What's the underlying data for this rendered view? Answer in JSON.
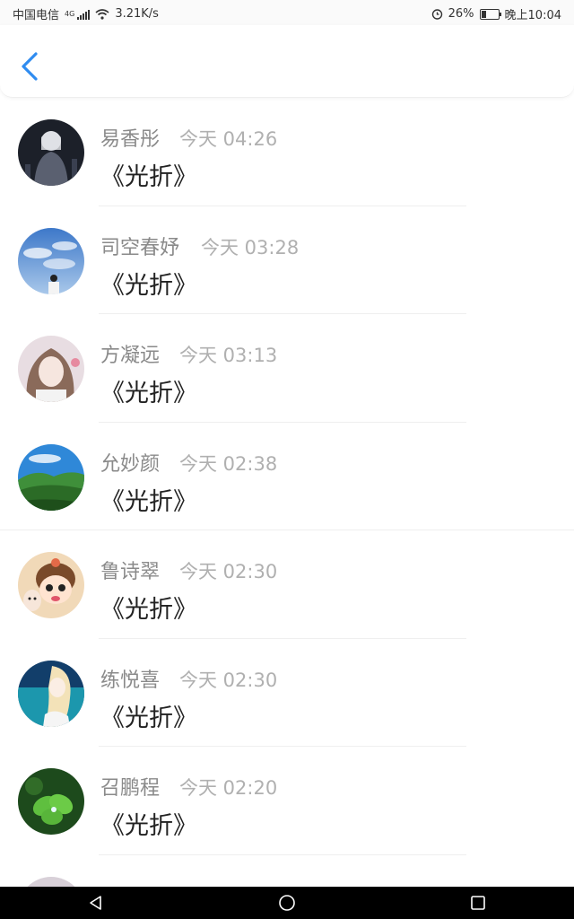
{
  "status_bar": {
    "carrier": "中国电信",
    "network": "4G",
    "speed": "3.21K/s",
    "battery": "26%",
    "time": "晚上10:04"
  },
  "header": {
    "back_icon": "chevron-left-icon"
  },
  "comments": [
    {
      "name": "易香彤",
      "time": "今天 04:26",
      "text": "《光折》"
    },
    {
      "name": "司空春妤",
      "time": "今天 03:28",
      "text": "《光折》"
    },
    {
      "name": "方凝远",
      "time": "今天 03:13",
      "text": "《光折》"
    },
    {
      "name": "允妙颜",
      "time": "今天 02:38",
      "text": "《光折》"
    },
    {
      "name": "鲁诗翠",
      "time": "今天 02:30",
      "text": "《光折》"
    },
    {
      "name": "练悦喜",
      "time": "今天 02:30",
      "text": "《光折》"
    },
    {
      "name": "召鹏程",
      "time": "今天 02:20",
      "text": "《光折》"
    }
  ],
  "colors": {
    "accent": "#2f8cf0",
    "name": "#8a8a8a",
    "time": "#b0b0b0",
    "text": "#222222"
  },
  "nav": {
    "back": "back-triangle-icon",
    "home": "home-circle-icon",
    "recent": "recent-square-icon"
  }
}
